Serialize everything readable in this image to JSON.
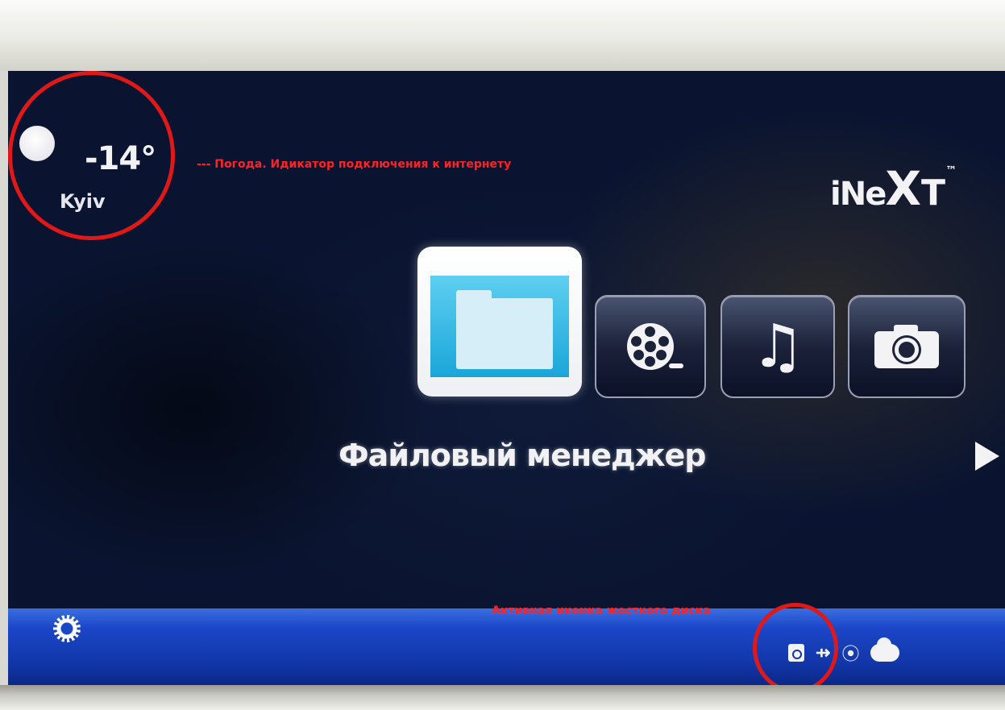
{
  "weather": {
    "icon": "moon-icon",
    "temperature": "-14°",
    "city": "Kyiv"
  },
  "annotations": {
    "weather_note": "--- Погода. Идикатор подключения к интернету",
    "hdd_note": "Активная иконка жесткого диска"
  },
  "logo": {
    "part1": "iNe",
    "part2": "X",
    "part3": "T",
    "tm": "™"
  },
  "menu": {
    "items": [
      {
        "name": "file-manager",
        "icon": "folder-icon",
        "selected": true
      },
      {
        "name": "video",
        "icon": "film-reel-icon",
        "selected": false
      },
      {
        "name": "music",
        "icon": "music-note-icon",
        "selected": false
      },
      {
        "name": "photo",
        "icon": "camera-icon",
        "selected": false
      }
    ],
    "selected_label": "Файловый менеджер",
    "music_glyph": "♫"
  },
  "status_bar": {
    "icons": [
      "gear-icon",
      "hard-disk-icon",
      "usb-icon",
      "wifi-icon",
      "cloud-icon"
    ],
    "usb_glyph": "⇸",
    "wifi_glyph": "⦿"
  },
  "colors": {
    "annotation": "#e01818",
    "accent": "#1b46c8"
  }
}
